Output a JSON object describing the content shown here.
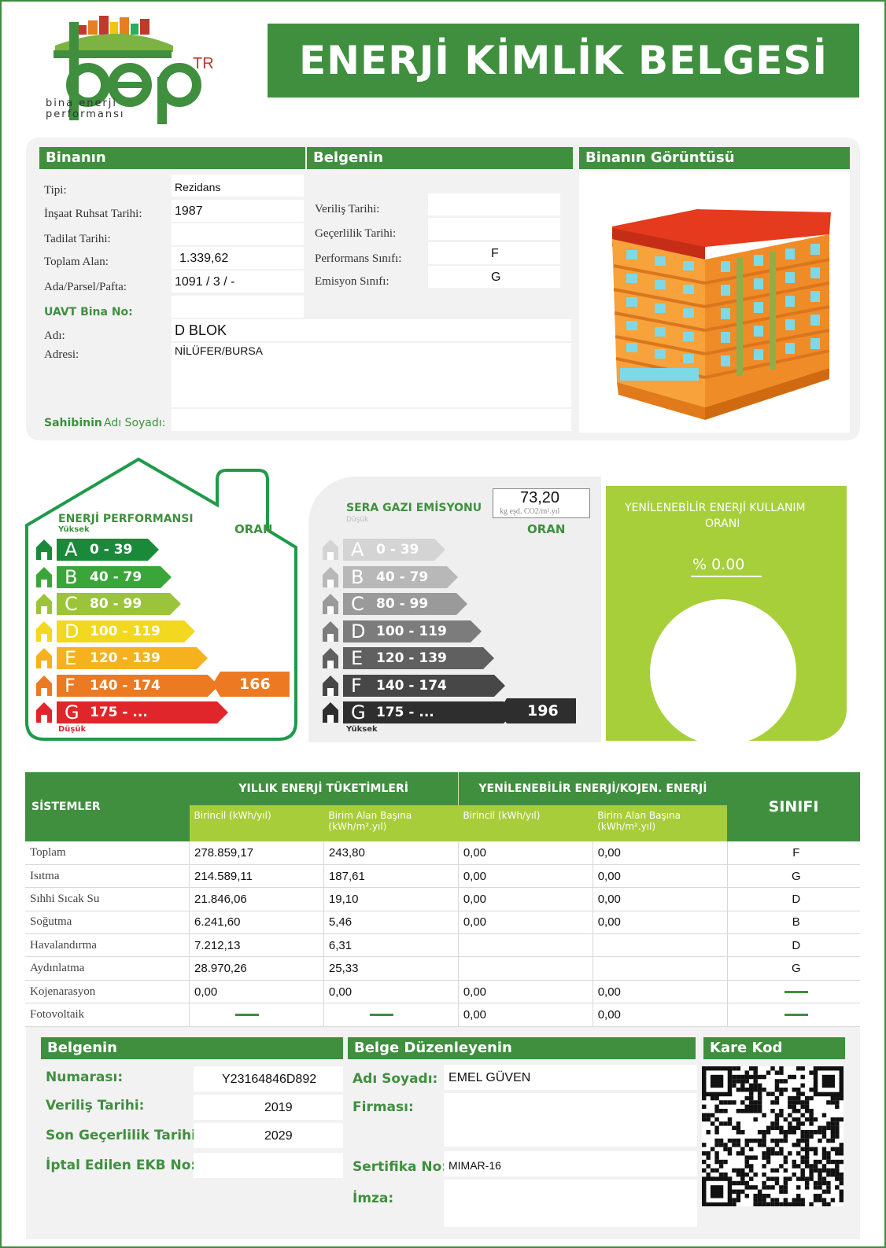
{
  "header": {
    "logo_text": "bep",
    "logo_sup": "TR",
    "logo_sub1": "bina enerji",
    "logo_sub2": "performansı",
    "title": "ENERJİ KİMLİK BELGESİ"
  },
  "bina": {
    "head": "Binanın",
    "tipi_label": "Tipi:",
    "tipi": "Rezidans",
    "ruhsat_label": "İnşaat Ruhsat Tarihi:",
    "ruhsat": "1987",
    "tadilat_label": "Tadilat Tarihi:",
    "tadilat": "",
    "alan_label": "Toplam Alan:",
    "alan": "1.339,62",
    "ada_label": "Ada/Parsel/Pafta:",
    "ada": "1091 / 3 / -",
    "uavt_label": "UAVT Bina No:",
    "uavt": "",
    "adi_label": "Adı:",
    "adi": "D BLOK",
    "adres_label": "Adresi:",
    "adres": "NİLÜFER/BURSA",
    "sahip_label_a": "Sahibinin",
    "sahip_label_b": "Adı Soyadı:",
    "sahip": ""
  },
  "belge": {
    "head": "Belgenin",
    "verilis_label": "Veriliş Tarihi:",
    "verilis": "",
    "gecerlilik_label": "Geçerlilik Tarihi:",
    "gecerlilik": "",
    "perf_label": "Performans Sınıfı:",
    "perf": "F",
    "emisyon_label": "Emisyon Sınıfı:",
    "emisyon": "G"
  },
  "goruntu": {
    "head": "Binanın Görüntüsü"
  },
  "energy": {
    "title": "ENERJİ PERFORMANSI",
    "high": "Yüksek",
    "low": "Düşük",
    "oran": "ORAN",
    "value": "166",
    "bands": [
      {
        "letter": "A",
        "range": "0 - 39",
        "color": "#1a8a3a"
      },
      {
        "letter": "B",
        "range": "40 - 79",
        "color": "#3aa63a"
      },
      {
        "letter": "C",
        "range": "80 - 99",
        "color": "#9cc43a"
      },
      {
        "letter": "D",
        "range": "100 - 119",
        "color": "#f2d81e"
      },
      {
        "letter": "E",
        "range": "120 - 139",
        "color": "#f5b21e"
      },
      {
        "letter": "F",
        "range": "140 - 174",
        "color": "#ec7a22"
      },
      {
        "letter": "G",
        "range": "175 - ...",
        "color": "#e0262a"
      }
    ]
  },
  "emission": {
    "title": "SERA GAZI EMİSYONU",
    "value_big": "73,20",
    "unit": "kg eşd. CO2/m².yıl",
    "low": "Düşük",
    "high": "Yüksek",
    "oran": "ORAN",
    "value": "196",
    "bands": [
      {
        "letter": "A",
        "range": "0 - 39",
        "color": "#d4d4d4"
      },
      {
        "letter": "B",
        "range": "40 - 79",
        "color": "#b8b8b8"
      },
      {
        "letter": "C",
        "range": "80 - 99",
        "color": "#9a9a9a"
      },
      {
        "letter": "D",
        "range": "100 - 119",
        "color": "#7c7c7c"
      },
      {
        "letter": "E",
        "range": "120 - 139",
        "color": "#606060"
      },
      {
        "letter": "F",
        "range": "140 - 174",
        "color": "#474747"
      },
      {
        "letter": "G",
        "range": "175 - ...",
        "color": "#2e2e2e"
      }
    ]
  },
  "renewable": {
    "title1": "YENİLENEBİLİR ENERJİ KULLANIM",
    "title2": "ORANI",
    "value": "% 0.00"
  },
  "systems": {
    "col_sistemler": "SİSTEMLER",
    "col_yillik": "YILLIK ENERJİ TÜKETİMLERİ",
    "col_yenilenebilir": "YENİLENEBİLİR ENERJİ/KOJEN. ENERJİ",
    "col_sinif": "SINIFI",
    "sub_birincil": "Birincil (kWh/yıl)",
    "sub_birim": "Birim Alan Başına (kWh/m².yıl)",
    "rows": [
      {
        "name": "Toplam",
        "b1": "278.859,17",
        "a1": "243,80",
        "b2": "0,00",
        "a2": "0,00",
        "cls": "F"
      },
      {
        "name": "Isıtma",
        "b1": "214.589,11",
        "a1": "187,61",
        "b2": "0,00",
        "a2": "0,00",
        "cls": "G"
      },
      {
        "name": "Sıhhi Sıcak Su",
        "b1": "21.846,06",
        "a1": "19,10",
        "b2": "0,00",
        "a2": "0,00",
        "cls": "D"
      },
      {
        "name": "Soğutma",
        "b1": "6.241,60",
        "a1": "5,46",
        "b2": "0,00",
        "a2": "0,00",
        "cls": "B"
      },
      {
        "name": "Havalandırma",
        "b1": "7.212,13",
        "a1": "6,31",
        "b2": "",
        "a2": "",
        "cls": "D"
      },
      {
        "name": "Aydınlatma",
        "b1": "28.970,26",
        "a1": "25,33",
        "b2": "",
        "a2": "",
        "cls": "G"
      },
      {
        "name": "Kojenarasyon",
        "b1": "0,00",
        "a1": "0,00",
        "b2": "0,00",
        "a2": "0,00",
        "cls": "—"
      },
      {
        "name": "Fotovoltaik",
        "b1": "—",
        "a1": "—",
        "b2": "0,00",
        "a2": "0,00",
        "cls": "—"
      }
    ]
  },
  "bottom": {
    "belge_head": "Belgenin",
    "numara_label": "Numarası:",
    "numara": "Y23164846D892",
    "verilis_label": "Veriliş Tarihi:",
    "verilis": "2019",
    "son_label": "Son Geçerlilik Tarihi:",
    "son": "2029",
    "iptal_label": "İptal Edilen EKB No:",
    "iptal": "",
    "duzen_head": "Belge Düzenleyenin",
    "adsoyad_label": "Adı Soyadı:",
    "adsoyad": "EMEL GÜVEN",
    "firma_label": "Firması:",
    "firma": "",
    "sertifika_label": "Sertifika No:",
    "sertifika": "MIMAR-16",
    "imza_label": "İmza:",
    "kare_head": "Kare Kod"
  }
}
